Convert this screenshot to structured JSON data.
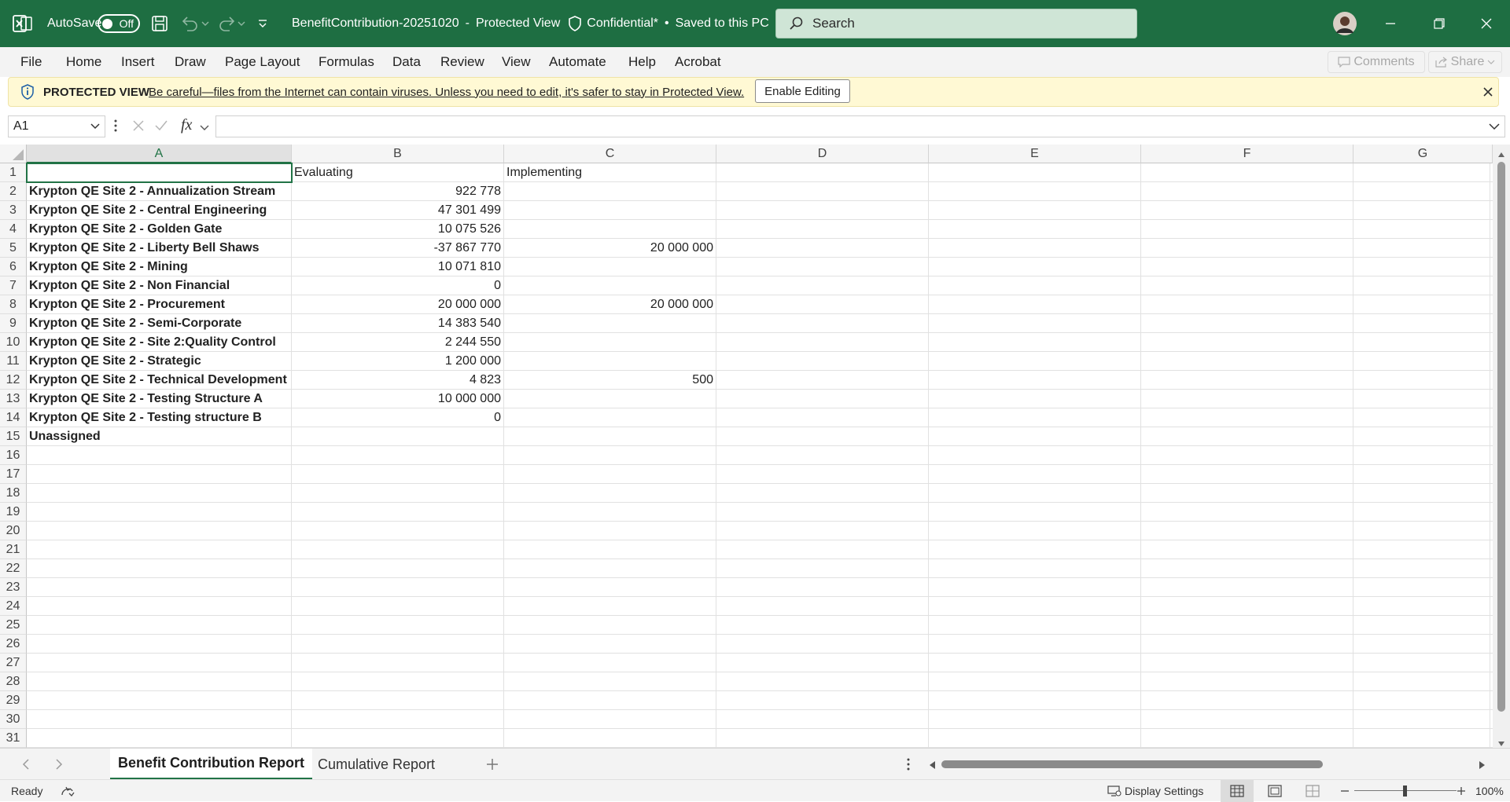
{
  "titlebar": {
    "autosave_label": "AutoSave",
    "autosave_state": "Off",
    "filename": "BenefitContribution-20251020",
    "separator": "-",
    "view_mode": "Protected View",
    "sensitivity": "Confidential*",
    "bullet": "•",
    "save_status": "Saved to this PC",
    "search_placeholder": "Search"
  },
  "ribbon_tabs": [
    "File",
    "Home",
    "Insert",
    "Draw",
    "Page Layout",
    "Formulas",
    "Data",
    "Review",
    "View",
    "Automate",
    "Help",
    "Acrobat"
  ],
  "ribbon_actions": {
    "comments_label": "Comments",
    "share_label": "Share"
  },
  "protected_view": {
    "title": "PROTECTED VIEW",
    "message": "Be careful—files from the Internet can contain viruses. Unless you need to edit, it's safer to stay in Protected View.",
    "button_label": "Enable Editing"
  },
  "formula_bar": {
    "name_box": "A1",
    "fx_label": "fx",
    "formula": ""
  },
  "sheet": {
    "columns": [
      "A",
      "B",
      "C",
      "D",
      "E",
      "F",
      "G"
    ],
    "selected_column": "A",
    "row_numbers": [
      "1",
      "2",
      "3",
      "4",
      "5",
      "6",
      "7",
      "8",
      "9",
      "10",
      "11",
      "12",
      "13",
      "14",
      "15",
      "16",
      "17",
      "18",
      "19",
      "20",
      "21",
      "22",
      "23",
      "24",
      "25",
      "26",
      "27",
      "28",
      "29",
      "30",
      "31"
    ],
    "rows": [
      {
        "a": "",
        "b": "Evaluating",
        "c": "Implementing"
      },
      {
        "a": "Krypton QE Site 2 - Annualization Stream",
        "b": "922 778",
        "c": ""
      },
      {
        "a": "Krypton QE Site 2 - Central Engineering",
        "b": "47 301 499",
        "c": ""
      },
      {
        "a": "Krypton QE Site 2 - Golden Gate",
        "b": "10 075 526",
        "c": ""
      },
      {
        "a": "Krypton QE Site 2 - Liberty Bell Shaws",
        "b": "-37 867 770",
        "c": "20 000 000"
      },
      {
        "a": "Krypton QE Site 2 - Mining",
        "b": "10 071 810",
        "c": ""
      },
      {
        "a": "Krypton QE Site 2 - Non Financial",
        "b": "0",
        "c": ""
      },
      {
        "a": "Krypton QE Site 2 - Procurement",
        "b": "20 000 000",
        "c": "20 000 000"
      },
      {
        "a": "Krypton QE Site 2 - Semi-Corporate",
        "b": "14 383 540",
        "c": ""
      },
      {
        "a": "Krypton QE Site 2 - Site 2:Quality Control",
        "b": "2 244 550",
        "c": ""
      },
      {
        "a": "Krypton QE Site 2 - Strategic",
        "b": "1 200 000",
        "c": ""
      },
      {
        "a": "Krypton QE Site 2 - Technical Development",
        "b": "4 823",
        "c": "500"
      },
      {
        "a": "Krypton QE Site 2 - Testing Structure A",
        "b": "10 000 000",
        "c": ""
      },
      {
        "a": "Krypton QE Site 2 - Testing structure B",
        "b": "0",
        "c": ""
      },
      {
        "a": "Unassigned",
        "b": "",
        "c": ""
      }
    ]
  },
  "sheet_tabs": [
    "Benefit Contribution Report",
    "Cumulative Report"
  ],
  "active_sheet": "Benefit Contribution Report",
  "statusbar": {
    "status": "Ready",
    "display_settings": "Display Settings",
    "zoom": "100%"
  },
  "colors": {
    "brand": "#1e6e42",
    "accent": "#217346",
    "protected_bg": "#fff9d4"
  }
}
